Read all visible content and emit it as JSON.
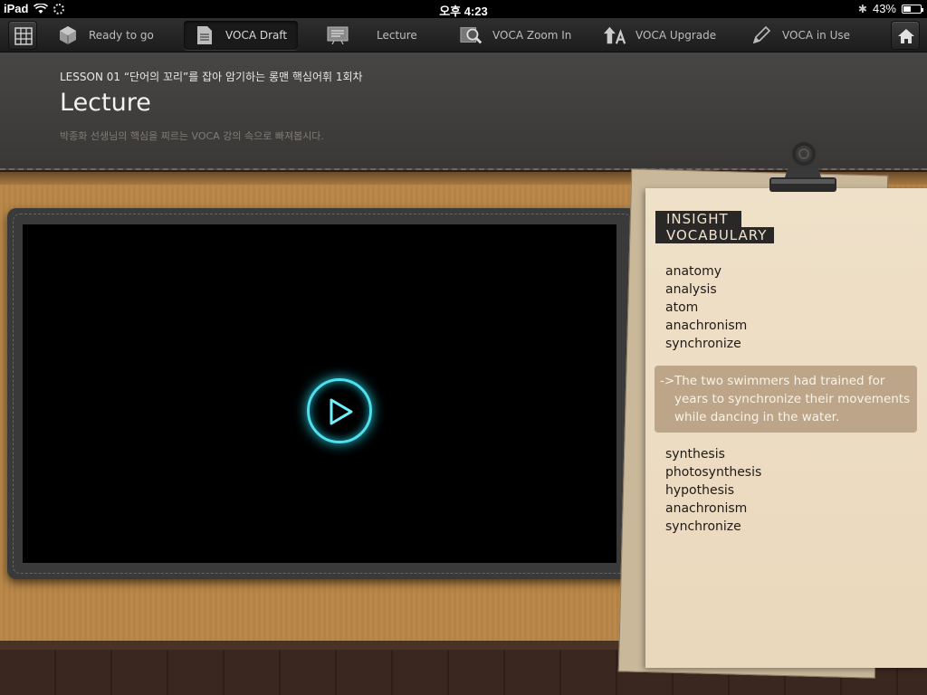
{
  "status_bar": {
    "device": "iPad",
    "time": "오후 4:23",
    "battery": "43%",
    "battery_level": 0.43
  },
  "nav": {
    "items": [
      {
        "label": "Ready to go",
        "icon": "cube-icon"
      },
      {
        "label": "VOCA Draft",
        "icon": "document-icon",
        "active": true
      },
      {
        "label": "Lecture",
        "icon": "lecture-board-icon"
      },
      {
        "label": "VOCA Zoom In",
        "icon": "magnifier-icon"
      },
      {
        "label": "VOCA Upgrade",
        "icon": "upgrade-arrow-icon"
      },
      {
        "label": "VOCA in Use",
        "icon": "pencil-icon"
      }
    ]
  },
  "header": {
    "lesson_line": "LESSON 01 “단어의 꼬리”를 잡아 암기하는 롱맨 핵심어휘 1회차",
    "title": "Lecture",
    "subtitle": "박종화 선생님의 핵심을 찌르는 VOCA 강의 속으로 빠져봅시다."
  },
  "vocab": {
    "tag_line1": "INSIGHT",
    "tag_line2": "VOCABULARY",
    "words_top": [
      "anatomy",
      "analysis",
      "atom",
      "anachronism",
      "synchronize"
    ],
    "example_arrow": "->",
    "example": "The two swimmers had trained for years to synchronize their movements while dancing in the water.",
    "words_bottom": [
      "synthesis",
      "photosynthesis",
      "hypothesis",
      "anachronism",
      "synchronize"
    ]
  },
  "colors": {
    "play_accent": "#4fe0ee",
    "nav_bg": "#242424",
    "paper": "#ecdcc2"
  }
}
